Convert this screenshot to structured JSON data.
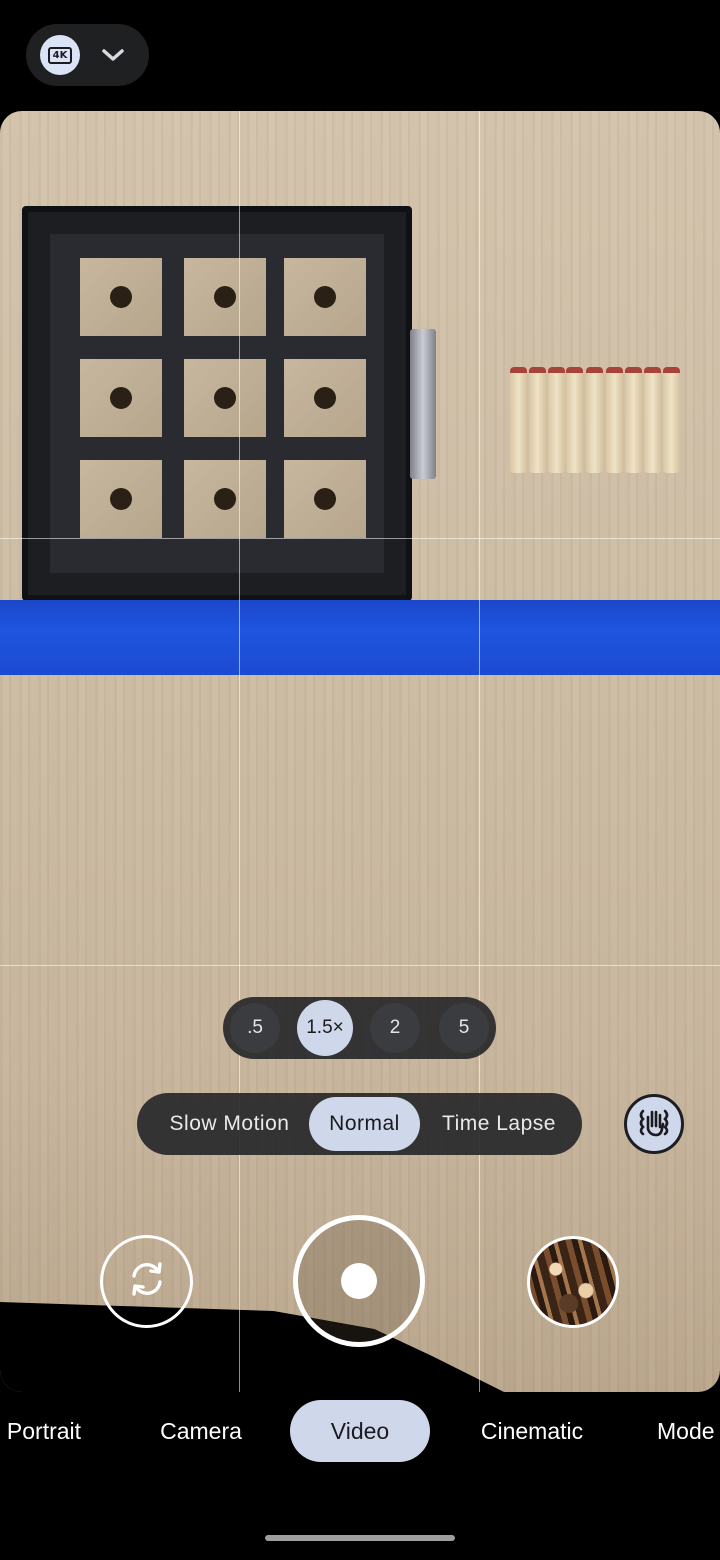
{
  "top_bar": {
    "resolution_badge": "4K",
    "resolution_menu_icon": "chevron-down-icon"
  },
  "viewfinder": {
    "grid": "3x3"
  },
  "zoom": {
    "options": [
      ".5",
      "1.5×",
      "2",
      "5"
    ],
    "selected": "1.5×"
  },
  "speed": {
    "options": [
      "Slow Motion",
      "Normal",
      "Time Lapse"
    ],
    "selected": "Normal"
  },
  "stabilization_icon": "hand-shake-stabilization-icon",
  "controls": {
    "switch_camera_icon": "switch-camera-icon",
    "record_icon": "record-icon",
    "gallery_icon": "gallery-thumbnail"
  },
  "modes": {
    "items": [
      "Portrait",
      "Camera",
      "Video",
      "Cinematic",
      "Mode"
    ],
    "selected": "Video"
  },
  "colors": {
    "accent": "#cfd8ea",
    "pill_bg": "#202124",
    "background": "#000000"
  }
}
